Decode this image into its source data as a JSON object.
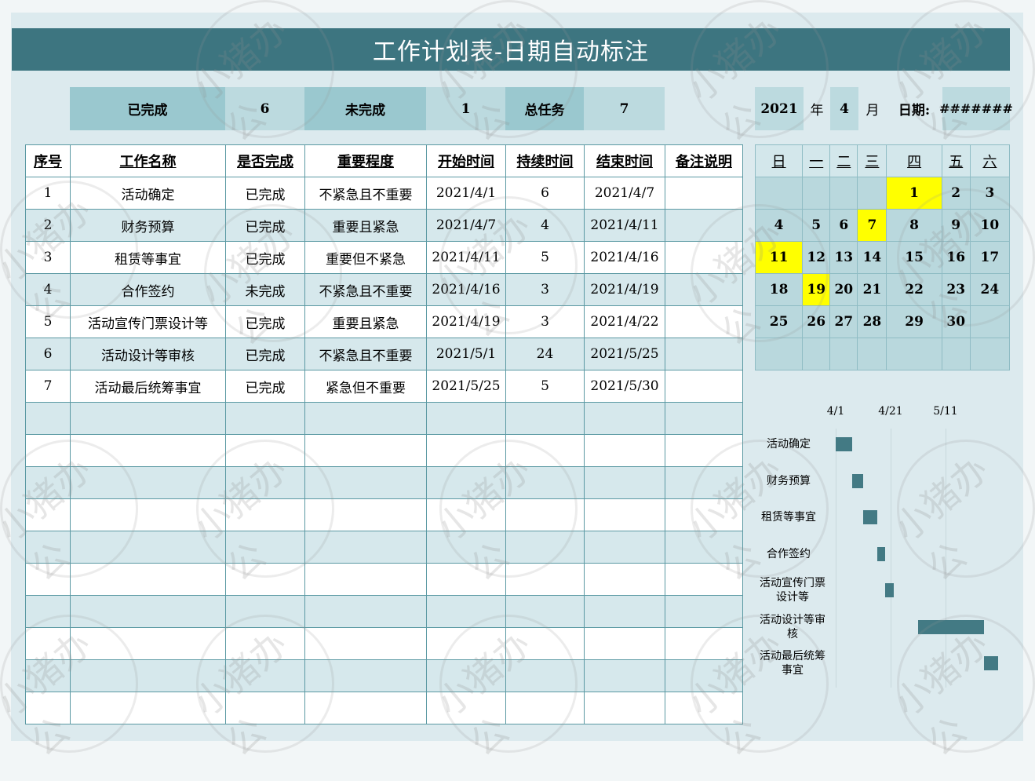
{
  "title": "工作计划表-日期自动标注",
  "summary": {
    "done_label": "已完成",
    "done_value": "6",
    "undone_label": "未完成",
    "undone_value": "1",
    "total_label": "总任务",
    "total_value": "7"
  },
  "date_box": {
    "year": "2021",
    "year_label": "年",
    "month": "4",
    "month_label": "月",
    "date_label": "日期:",
    "date_value": "#######"
  },
  "table": {
    "headers": [
      "序号",
      "工作名称",
      "是否完成",
      "重要程度",
      "开始时间",
      "持续时间",
      "结束时间",
      "备注说明"
    ],
    "rows": [
      [
        "1",
        "活动确定",
        "已完成",
        "不紧急且不重要",
        "2021/4/1",
        "6",
        "2021/4/7",
        ""
      ],
      [
        "2",
        "财务预算",
        "已完成",
        "重要且紧急",
        "2021/4/7",
        "4",
        "2021/4/11",
        ""
      ],
      [
        "3",
        "租赁等事宜",
        "已完成",
        "重要但不紧急",
        "2021/4/11",
        "5",
        "2021/4/16",
        ""
      ],
      [
        "4",
        "合作签约",
        "未完成",
        "不紧急且不重要",
        "2021/4/16",
        "3",
        "2021/4/19",
        ""
      ],
      [
        "5",
        "活动宣传门票设计等",
        "已完成",
        "重要且紧急",
        "2021/4/19",
        "3",
        "2021/4/22",
        ""
      ],
      [
        "6",
        "活动设计等审核",
        "已完成",
        "不紧急且不重要",
        "2021/5/1",
        "24",
        "2021/5/25",
        ""
      ],
      [
        "7",
        "活动最后统筹事宜",
        "已完成",
        "紧急但不重要",
        "2021/5/25",
        "5",
        "2021/5/30",
        ""
      ]
    ],
    "empty_rows": 10
  },
  "calendar": {
    "weekdays": [
      "日",
      "一",
      "二",
      "三",
      "四",
      "五",
      "六"
    ],
    "weeks": [
      [
        "",
        "",
        "",
        "",
        "1",
        "2",
        "3"
      ],
      [
        "4",
        "5",
        "6",
        "7",
        "8",
        "9",
        "10"
      ],
      [
        "11",
        "12",
        "13",
        "14",
        "15",
        "16",
        "17"
      ],
      [
        "18",
        "19",
        "20",
        "21",
        "22",
        "23",
        "24"
      ],
      [
        "25",
        "26",
        "27",
        "28",
        "29",
        "30",
        ""
      ],
      [
        "",
        "",
        "",
        "",
        "",
        "",
        ""
      ]
    ],
    "highlighted": [
      "1",
      "7",
      "11",
      "19"
    ]
  },
  "chart_data": {
    "type": "bar",
    "orientation": "horizontal-gantt",
    "x_ticks": [
      "4/1",
      "4/21",
      "5/11"
    ],
    "tasks": [
      {
        "label": "活动确定",
        "start": "2021/4/1",
        "duration": 6
      },
      {
        "label": "财务预算",
        "start": "2021/4/7",
        "duration": 4
      },
      {
        "label": "租赁等事宜",
        "start": "2021/4/11",
        "duration": 5
      },
      {
        "label": "合作签约",
        "start": "2021/4/16",
        "duration": 3
      },
      {
        "label": "活动宣传门票设计等",
        "start": "2021/4/19",
        "duration": 3
      },
      {
        "label": "活动设计等审核",
        "start": "2021/5/1",
        "duration": 24
      },
      {
        "label": "活动最后统筹事宜",
        "start": "2021/5/25",
        "duration": 5
      }
    ],
    "bar_color": "#437a84"
  },
  "watermark": "小猪办公",
  "colors": {
    "title_bg": "#3d7580",
    "highlight": "#ffff00",
    "sheet_bg": "#dceaee"
  }
}
